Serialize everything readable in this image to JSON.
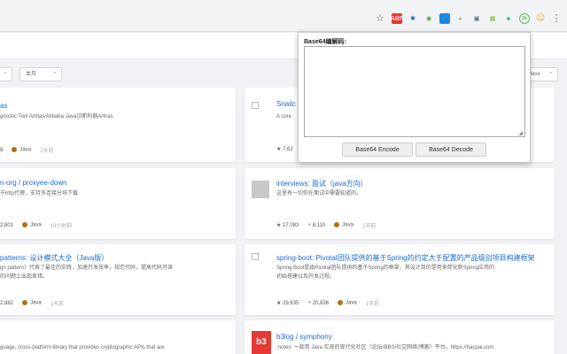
{
  "toolbar": {
    "extensions": [
      {
        "name": "bookmark-star-icon",
        "glyph": "☆",
        "color": "#5f6368"
      },
      {
        "name": "abp-icon",
        "glyph": "●",
        "color": "#e53935"
      },
      {
        "name": "pinwheel-icon",
        "glyph": "✱",
        "color": "#1565c0"
      },
      {
        "name": "chrome-ext-icon",
        "glyph": "◉",
        "color": "#43a047"
      },
      {
        "name": "blue-square-icon",
        "glyph": "■",
        "color": "#1e88e5"
      },
      {
        "name": "play-icon",
        "glyph": "▸",
        "color": "#9e9e9e"
      },
      {
        "name": "package-icon",
        "glyph": "▣",
        "color": "#546e7a"
      },
      {
        "name": "grid-icon",
        "glyph": "▦",
        "color": "#7cb342"
      },
      {
        "name": "diamond-icon",
        "glyph": "◈",
        "color": "#26a69a"
      },
      {
        "name": "green-circle-icon",
        "glyph": "◎",
        "color": "#66bb6a"
      },
      {
        "name": "emoji-icon",
        "glyph": "☺",
        "color": "#f9a825"
      },
      {
        "name": "menu-kebab-icon",
        "glyph": "⋮",
        "color": "#5f6368"
      }
    ],
    "green_badge": "2k"
  },
  "filters": {
    "period": "本月",
    "language": "Java"
  },
  "popup": {
    "label": "Base64编解码:",
    "encode_label": "Base64 Encode",
    "decode_label": "Base64 Decode",
    "textarea_value": ""
  },
  "cards": [
    {
      "title": "as",
      "desc": [
        "gnostic Tool Arthas/Alibaba Java诊断利器Arthas"
      ],
      "meta": [
        "8",
        "Java",
        "2天前"
      ]
    },
    {
      "title": "Snailc",
      "desc": [
        "A core"
      ],
      "meta": [
        "7,62"
      ]
    },
    {
      "title": "n-org / proxyee-down",
      "desc": [
        "于http代理，支持多连接分块下载"
      ],
      "meta": [
        "2,801",
        "Java",
        "19小时前"
      ]
    },
    {
      "title": "interviews: 面试（java方向）",
      "desc": [
        "这里有一切你在面试中需要知道的。"
      ],
      "meta": [
        "27,083",
        "8,110",
        "Java",
        "2天前"
      ]
    },
    {
      "title": "patterns: 设计模式大全（Java版）",
      "desc": [
        "gn pattern）代表了最佳的实践，加速开发效率，规范代码，提高代码可读",
        "的问题上出现差错。"
      ],
      "meta": [
        "2,882",
        "Java",
        "1天前"
      ]
    },
    {
      "title": "spring-boot: Pivotal团队提供的基于Spring的约定大于配置的产品级别项目构建框架",
      "desc": [
        "Spring Boot是由Pivotal团队提供的基于Spring的框架，其设计目的是用来简化新Spring应用的",
        "初始搭建以及开发过程。"
      ],
      "meta": [
        "29,635",
        "20,836",
        "Java",
        "1天前"
      ]
    },
    {
      "title": "",
      "desc": [
        "guage, cross-platform library that provides cryptographic APIs that are"
      ],
      "meta": []
    },
    {
      "title": "b3log / symphony",
      "desc": [
        ":notes: 一款用 Java 实现的现代化社区（论坛/BBS/社交网络/博客）平台。https://hacpai.com"
      ],
      "meta": []
    }
  ]
}
